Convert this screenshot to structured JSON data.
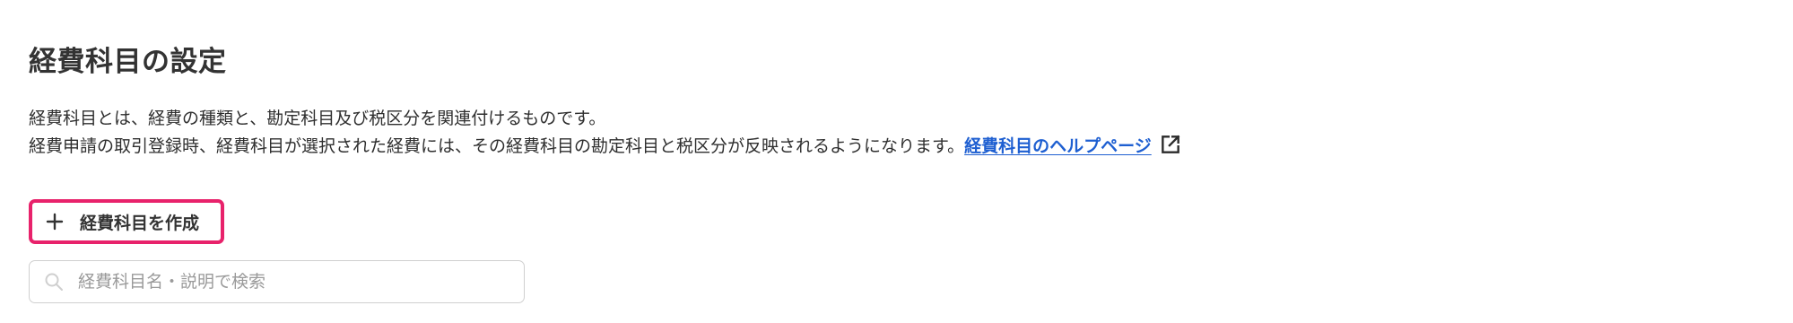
{
  "header": {
    "title": "経費科目の設定"
  },
  "description": {
    "line1": "経費科目とは、経費の種類と、勘定科目及び税区分を関連付けるものです。",
    "line2": "経費申請の取引登録時、経費科目が選択された経費には、その経費科目の勘定科目と税区分が反映されるようになります。",
    "help_link_label": "経費科目のヘルプページ",
    "help_link_icon": "external-link-icon"
  },
  "actions": {
    "create_label": "経費科目を作成",
    "create_icon": "plus-icon",
    "highlight_color": "#e8226b"
  },
  "search": {
    "placeholder": "経費科目名・説明で検索",
    "value": "",
    "icon": "search-icon"
  },
  "colors": {
    "link": "#1e5fd1",
    "text": "#2f2f2f"
  }
}
